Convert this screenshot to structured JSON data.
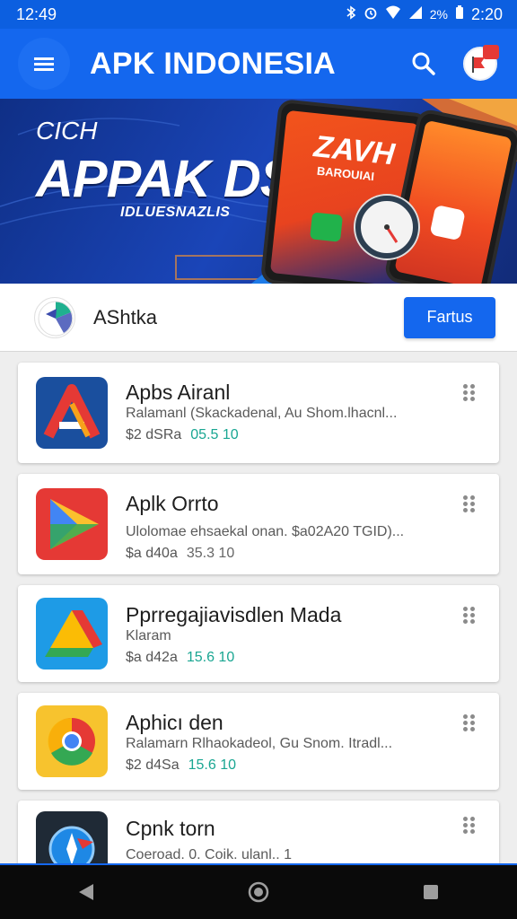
{
  "status_bar": {
    "time_left": "12:49",
    "battery_text": "2%",
    "time_right": "2:20",
    "icons": [
      "bluetooth-icon",
      "alarm-icon",
      "wifi-icon",
      "signal-icon",
      "battery-icon"
    ]
  },
  "app_bar": {
    "title": "APK INDONESIA",
    "color": "#1467ee"
  },
  "banner": {
    "eyebrow": "CICH",
    "headline": "APPAK DSIA",
    "subline": "IDLUESNAZLIS",
    "phone_title": "ZAVH",
    "phone_sub": "BAROUIAI"
  },
  "featured": {
    "label": "AShtka",
    "button_label": "Fartus"
  },
  "apps": [
    {
      "title": "Apbs Airanl",
      "desc": "Ralamanl (Skackadenal, Au Shom.lhacnl...",
      "size": "$2 dSRa",
      "version": "05.5 10",
      "icon": "app-a-icon"
    },
    {
      "title": "Aplk Orrto",
      "desc": "Ulolomae ehsaekal onan. $a02A20 TGID)...",
      "size": "$a d40a",
      "version": "35.3 10",
      "icon": "play-icon"
    },
    {
      "title": "Pprregajiavisdlen Mada",
      "desc": "Klaram",
      "size": "$a d42a",
      "version": "15.6 10",
      "icon": "drive-icon"
    },
    {
      "title": "Aphicı den",
      "desc": "Ralamarn Rlhaokadeol, Gu Snom. Itradl...",
      "size": "$2 d4Sa",
      "version": "15.6 10",
      "icon": "chrome-icon"
    },
    {
      "title": "Cpnk torn",
      "desc": "Coeroad. 0. Coik. ulanl.. 1",
      "size": "",
      "version": "",
      "icon": "compass-icon"
    }
  ],
  "colors": {
    "accent": "#1467ee",
    "version_teal": "#19a692"
  }
}
